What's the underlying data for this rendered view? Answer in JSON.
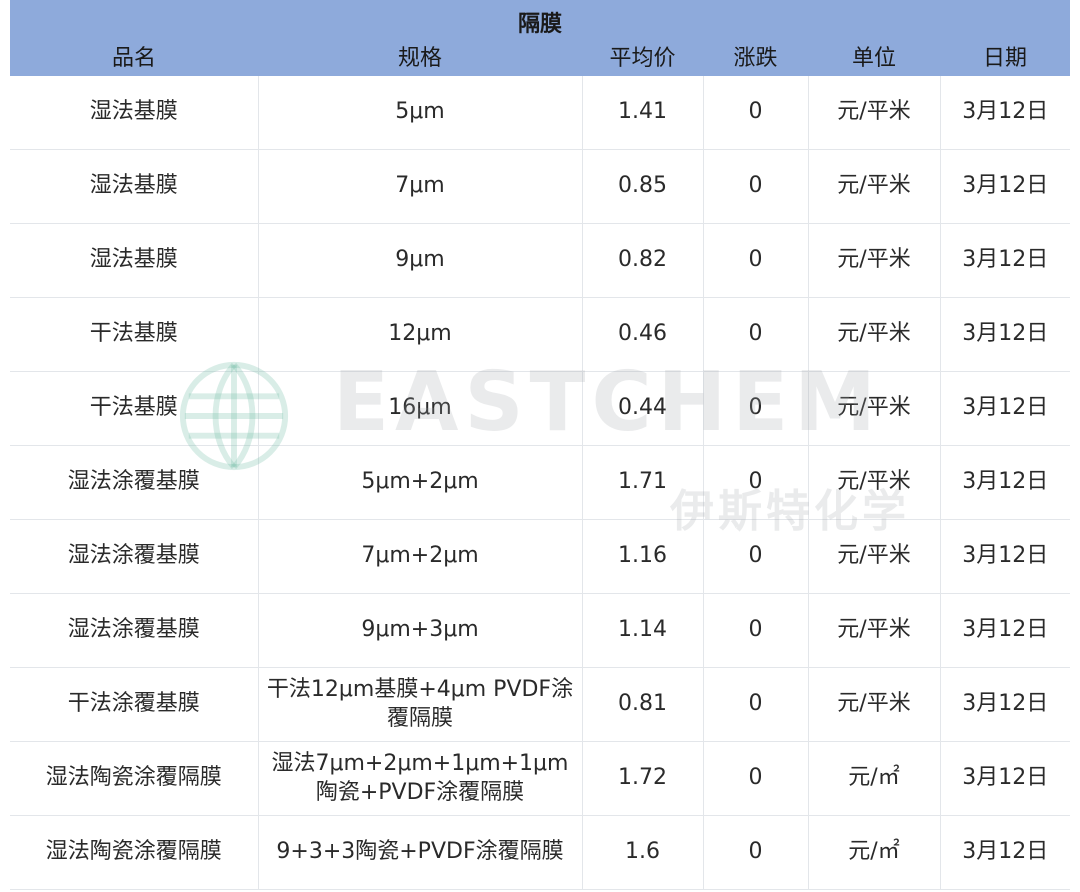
{
  "table_title": "隔膜",
  "headers": [
    "品名",
    "规格",
    "平均价",
    "涨跌",
    "单位",
    "日期"
  ],
  "rows": [
    [
      "湿法基膜",
      "5μm",
      "1.41",
      "0",
      "元/平米",
      "3月12日"
    ],
    [
      "湿法基膜",
      "7μm",
      "0.85",
      "0",
      "元/平米",
      "3月12日"
    ],
    [
      "湿法基膜",
      "9μm",
      "0.82",
      "0",
      "元/平米",
      "3月12日"
    ],
    [
      "干法基膜",
      "12μm",
      "0.46",
      "0",
      "元/平米",
      "3月12日"
    ],
    [
      "干法基膜",
      "16μm",
      "0.44",
      "0",
      "元/平米",
      "3月12日"
    ],
    [
      "湿法涂覆基膜",
      "5μm+2μm",
      "1.71",
      "0",
      "元/平米",
      "3月12日"
    ],
    [
      "湿法涂覆基膜",
      "7μm+2μm",
      "1.16",
      "0",
      "元/平米",
      "3月12日"
    ],
    [
      "湿法涂覆基膜",
      "9μm+3μm",
      "1.14",
      "0",
      "元/平米",
      "3月12日"
    ],
    [
      "干法涂覆基膜",
      "干法12μm基膜+4μm PVDF涂覆隔膜",
      "0.81",
      "0",
      "元/平米",
      "3月12日"
    ],
    [
      "湿法陶瓷涂覆隔膜",
      "湿法7μm+2μm+1μm+1μm陶瓷+PVDF涂覆隔膜",
      "1.72",
      "0",
      "元/㎡",
      "3月12日"
    ],
    [
      "湿法陶瓷涂覆隔膜",
      "9+3+3陶瓷+PVDF涂覆隔膜",
      "1.6",
      "0",
      "元/㎡",
      "3月12日"
    ]
  ],
  "watermark": {
    "en": "EASTCHEM",
    "cn": "伊斯特化学",
    "icon": "globe-logo-icon"
  },
  "colors": {
    "header_bg": "#8eaadb",
    "border": "#e3e6ea",
    "text": "#2a2a2a"
  }
}
